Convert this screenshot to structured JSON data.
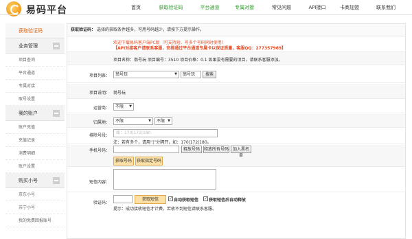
{
  "header": {
    "brand": "易码平台",
    "nav": [
      "首页",
      "获取验证码",
      "平台通道",
      "专属对接",
      "常见问题",
      "API接口",
      "卡商加盟",
      "联系我们"
    ]
  },
  "sidebar": {
    "sections": [
      {
        "title": "获取验证码",
        "items": []
      },
      {
        "title": "业务管理",
        "items": [
          "项目查询",
          "平台通道",
          "专属对接",
          "取号设置"
        ]
      },
      {
        "title": "我的账户",
        "items": [
          "账户充值",
          "充值记录",
          "消费明细",
          "账户设置"
        ]
      },
      {
        "title": "购买小号",
        "items": [
          "京东小号",
          "苏宁小号",
          "我的免费回报账号"
        ]
      }
    ]
  },
  "main": {
    "info_label": "获取验证码：",
    "info_text": "选择的获取条件越多，可用号码越少，请按下方提示操作。",
    "notice_line1": "欢迎下载易码客户端PC版（可支持短、号多个号码同时使用）",
    "notice_line2": "【API对接客户请联系客服，安排通过平台通道专属卡以保证质量，客服QQ：277357969】",
    "project_info": "项目名称：翁号玩 项目编号：3510 项目价格：0.1 如果没有需要的项目，请联系客服添加。",
    "project_list_label": "项目列表：",
    "project_select": "翁号玩",
    "project_input": "翁号玩",
    "search_btn": "搜索",
    "project_desc_label": "项目说明：",
    "project_desc": "翁号玩",
    "operator_label": "运营商：",
    "operator_value": "不限",
    "region_label": "归属地：",
    "region_province": "不限",
    "region_city": "不限",
    "exclude_label": "排除号段：",
    "exclude_placeholder": "如：170|172|180",
    "exclude_hint": "注：若有多个，请用“|”分隔开，如：170|172|180。",
    "phone_label": "手机号码：",
    "btn_release": "释放号码",
    "btn_release_all": "释放所有号码",
    "btn_blacklist": "加入黑名单",
    "btn_get_number": "获取号码",
    "btn_get_specific": "获取指定号码",
    "sms_label": "短信内容：",
    "code_label": "验证码：",
    "btn_get_sms": "获取短信",
    "auto_get": "自动获取短信",
    "auto_release": "获取短信后自动释放",
    "code_hint": "提示：成功接收短信才计费，若收不到短信请联系客服。"
  }
}
